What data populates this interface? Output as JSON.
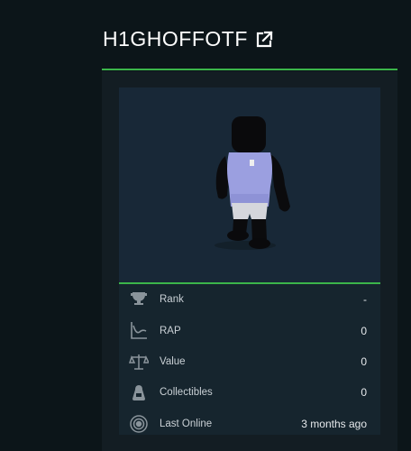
{
  "profile": {
    "username": "H1GHOFFOTF",
    "external_link_icon": "external-link-icon"
  },
  "colors": {
    "accent": "#3bb54a",
    "background": "#0c1519",
    "card": "#16252e"
  },
  "stats": [
    {
      "icon": "trophy-icon",
      "label": "Rank",
      "value": "-"
    },
    {
      "icon": "chart-icon",
      "label": "RAP",
      "value": "0"
    },
    {
      "icon": "scale-icon",
      "label": "Value",
      "value": "0"
    },
    {
      "icon": "collectibles-icon",
      "label": "Collectibles",
      "value": "0"
    },
    {
      "icon": "online-icon",
      "label": "Last Online",
      "value": "3 months ago"
    }
  ]
}
